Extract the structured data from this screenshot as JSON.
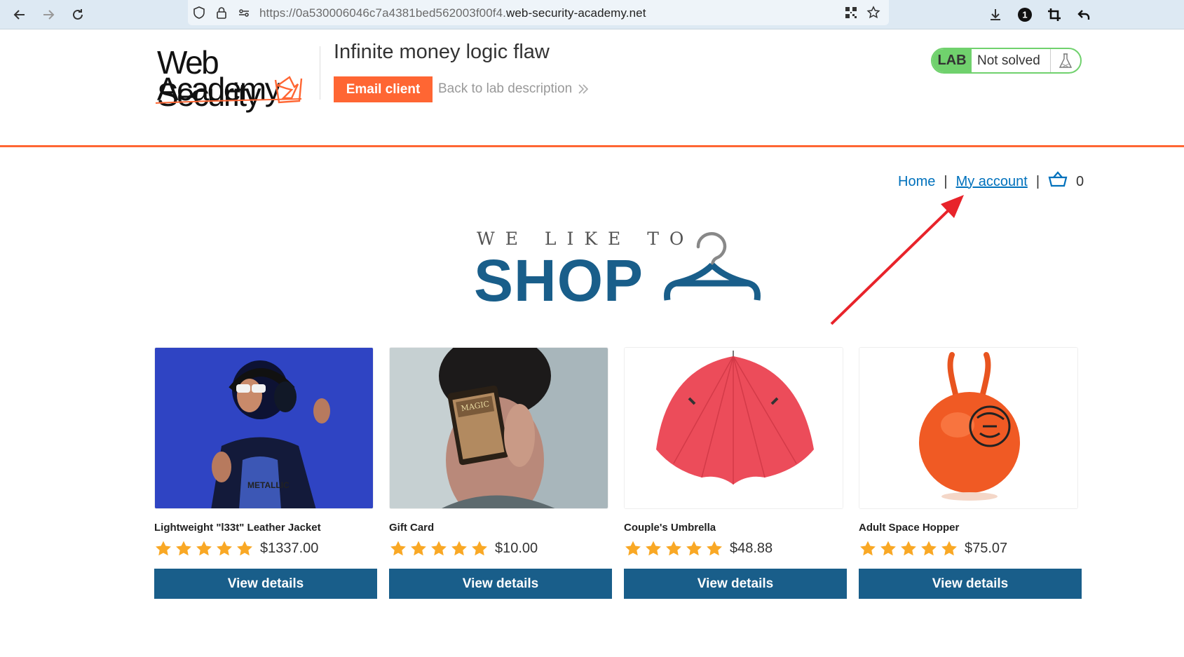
{
  "browser": {
    "url_prefix": "https://0a530006046c7a4381bed562003f00f4.",
    "url_domain": "web-security-academy.net",
    "badge_count": "1"
  },
  "lab_header": {
    "logo_line1": "Web Security",
    "logo_line2": "Academy",
    "title": "Infinite money logic flaw",
    "email_client": "Email client",
    "back_link": "Back to lab description",
    "status_tag": "LAB",
    "status_text": "Not solved"
  },
  "nav": {
    "home": "Home",
    "separator": "|",
    "my_account": "My account",
    "cart_count": "0"
  },
  "hero": {
    "small": "WE LIKE TO",
    "big": "SHOP"
  },
  "products": [
    {
      "name": "Lightweight \"l33t\" Leather Jacket",
      "rating": 5,
      "price": "$1337.00",
      "button": "View details"
    },
    {
      "name": "Gift Card",
      "rating": 5,
      "price": "$10.00",
      "button": "View details"
    },
    {
      "name": "Couple's Umbrella",
      "rating": 5,
      "price": "$48.88",
      "button": "View details"
    },
    {
      "name": "Adult Space Hopper",
      "rating": 5,
      "price": "$75.07",
      "button": "View details"
    }
  ],
  "colors": {
    "accent": "#ff6633",
    "primary": "#195e8a",
    "link": "#0071bc",
    "star": "#f9a825",
    "lab_green": "#70d16d",
    "annotation_arrow": "#e8232a"
  }
}
